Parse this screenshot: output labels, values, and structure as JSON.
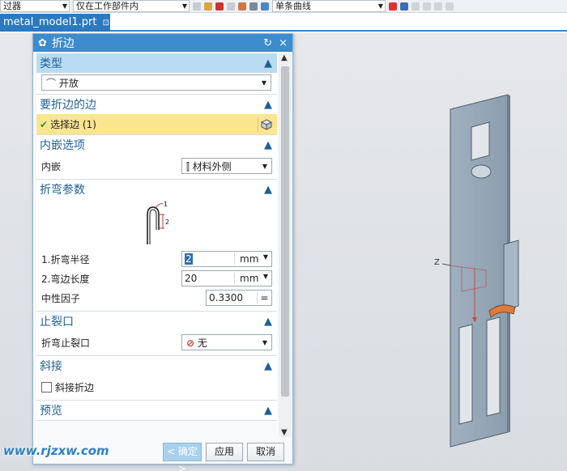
{
  "toolbar": {
    "filter_select": "过器",
    "scope_select": "仅在工作部件内",
    "curve_select": "单条曲线"
  },
  "tabs": [
    {
      "label": "metal_model1.prt",
      "pin": "⊡",
      "close": "×"
    }
  ],
  "dialog": {
    "title": "折边",
    "reset_icon": "↻",
    "close_icon": "×",
    "sections": {
      "type": {
        "header": "类型",
        "value": "开放"
      },
      "edge": {
        "header": "要折边的边",
        "select_label": "选择边 (1)"
      },
      "inset": {
        "header": "内嵌选项",
        "label": "内嵌",
        "value": "材料外侧"
      },
      "bend": {
        "header": "折弯参数",
        "fig_label_1": "1",
        "fig_label_2": "2",
        "radius_label": "1.折弯半径",
        "radius_value": "2",
        "radius_unit": "mm",
        "length_label": "2.弯边长度",
        "length_value": "20",
        "length_unit": "mm",
        "k_label": "中性因子",
        "k_value": "0.3300",
        "k_eq": "="
      },
      "relief": {
        "header": "止裂口",
        "label": "折弯止裂口",
        "value": "无"
      },
      "miter": {
        "header": "斜接",
        "checkbox_label": "斜接折边"
      },
      "preview": {
        "header": "预览"
      }
    },
    "buttons": {
      "ok": "< 确定 >",
      "apply": "应用",
      "cancel": "取消"
    }
  },
  "watermark": "www.rjzxw.com",
  "axis_label": "Z",
  "colors": {
    "title_bar": "#3d8ccd",
    "section_active": "#b9dcf3",
    "selection": "#fbe58f",
    "accent": "#1f5f95"
  }
}
